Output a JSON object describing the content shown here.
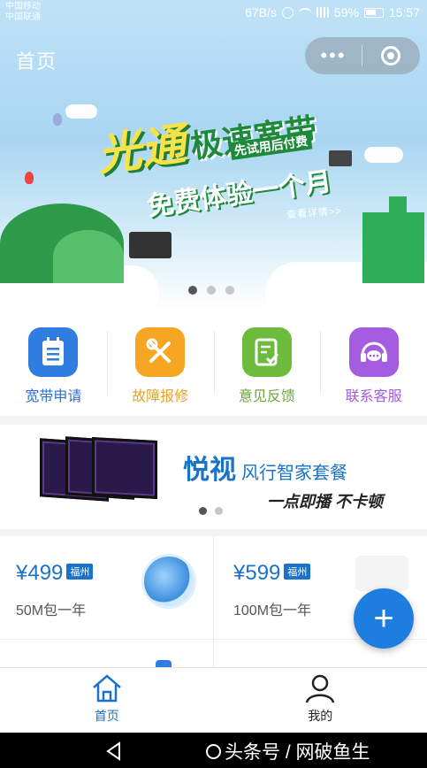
{
  "status_bar": {
    "carrier_line1": "中国移动",
    "carrier_line2": "中国联通",
    "speed": "67B/s",
    "battery": "59%",
    "time": "15:57"
  },
  "header": {
    "title": "首页",
    "more_icon": "more-dots-icon",
    "close_icon": "target-icon"
  },
  "banner": {
    "headline_a": "光通",
    "headline_b": "极速宽带",
    "note": "先试用后付费",
    "subline": "免费体验一个月",
    "link": "查看详情>>",
    "slides": 3,
    "active_slide": 0
  },
  "services": [
    {
      "label": "宽带申请",
      "icon": "notepad-icon",
      "color": "#2f7de0",
      "text_color": "#2f6fc7"
    },
    {
      "label": "故障报修",
      "icon": "tools-icon",
      "color": "#f6a623",
      "text_color": "#e7a12f"
    },
    {
      "label": "意见反馈",
      "icon": "feedback-icon",
      "color": "#6cbb3c",
      "text_color": "#6aa83c"
    },
    {
      "label": "联系客服",
      "icon": "headset-icon",
      "color": "#a45de0",
      "text_color": "#9d5ed8"
    }
  ],
  "promo": {
    "title_a": "悦视",
    "title_b": "风行智家套餐",
    "subtitle": "一点即播 不卡顿",
    "slides": 2,
    "active_slide": 0
  },
  "products": [
    {
      "price": "¥499",
      "tag": "福州",
      "desc": "50M包一年"
    },
    {
      "price": "¥599",
      "tag": "福州",
      "desc": "100M包一年"
    }
  ],
  "fab": {
    "label": "+"
  },
  "tabbar": [
    {
      "label": "首页",
      "icon": "home-icon",
      "active": true
    },
    {
      "label": "我的",
      "icon": "user-icon",
      "active": false
    }
  ],
  "navbar": {
    "back_icon": "back-triangle-icon",
    "watermark": "头条号 / 网破鱼生"
  }
}
